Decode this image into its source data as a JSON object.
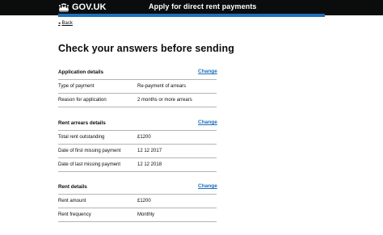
{
  "header": {
    "logo_text": "GOV.UK",
    "service_name": "Apply for direct rent payments"
  },
  "nav": {
    "back_label": "Back"
  },
  "page_title": "Check your answers before sending",
  "sections": [
    {
      "title": "Application details",
      "change_label": "Change",
      "rows": [
        {
          "key": "Type of payment",
          "value": "Re-payment of arrears"
        },
        {
          "key": "Reason for application",
          "value": "2 months or more arrears"
        }
      ]
    },
    {
      "title": "Rent arrears details",
      "change_label": "Change",
      "rows": [
        {
          "key": "Total rent outstanding",
          "value": "£1200"
        },
        {
          "key": "Date of first missing payment",
          "value": "12 12 2017"
        },
        {
          "key": "Date of last missing payment",
          "value": "12 12 2018"
        }
      ]
    },
    {
      "title": "Rent details",
      "change_label": "Change",
      "rows": [
        {
          "key": "Rent amount",
          "value": "£1200"
        },
        {
          "key": "Rent frequency",
          "value": "Monthly"
        }
      ]
    }
  ],
  "icons": {
    "logo": "crown-icon",
    "back": "chevron-left-icon"
  },
  "colors": {
    "header_bg": "#0b0c0c",
    "accent_bar": "#1d70b8",
    "link": "#1d70b8",
    "divider": "#b1b4b6"
  }
}
